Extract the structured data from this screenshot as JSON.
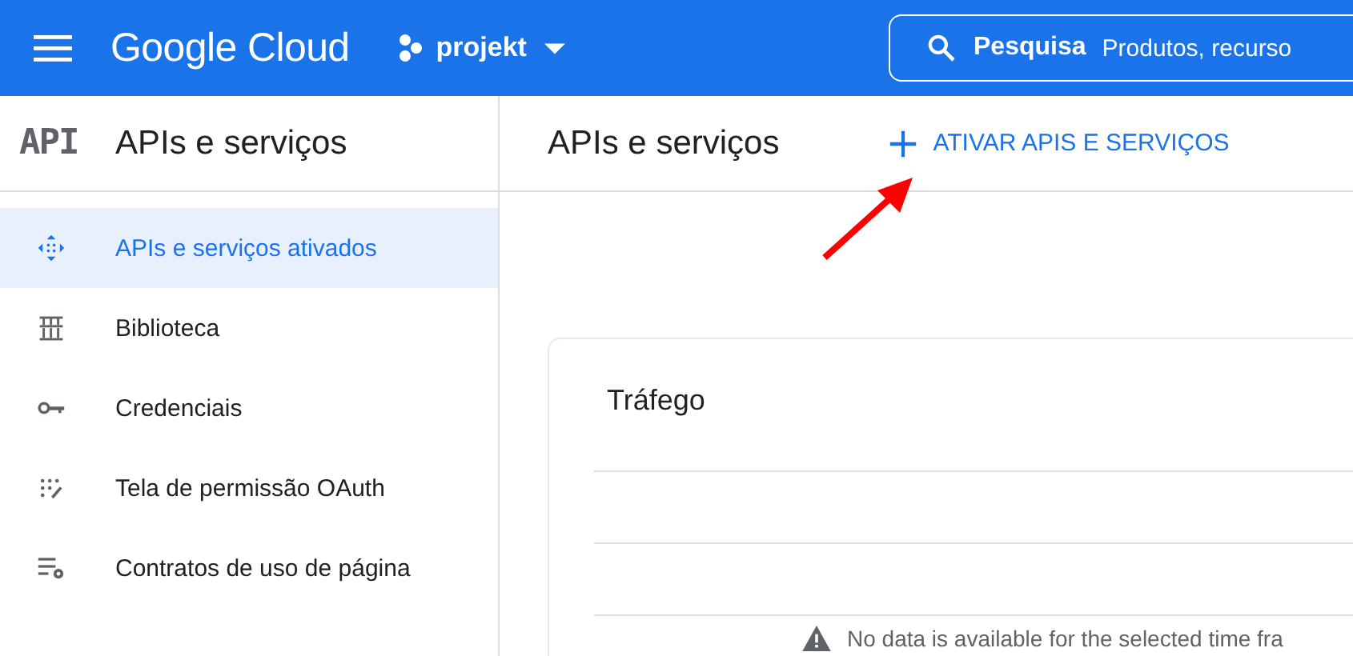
{
  "header": {
    "brand": "Google Cloud",
    "project": "projekt",
    "search": {
      "label": "Pesquisa",
      "placeholder": "Produtos, recurso"
    }
  },
  "sidebar": {
    "logo": "API",
    "title": "APIs e serviços",
    "items": [
      {
        "label": "APIs e serviços ativados",
        "selected": true
      },
      {
        "label": "Biblioteca",
        "selected": false
      },
      {
        "label": "Credenciais",
        "selected": false
      },
      {
        "label": "Tela de permissão OAuth",
        "selected": false
      },
      {
        "label": "Contratos de uso de página",
        "selected": false
      }
    ]
  },
  "main": {
    "title": "APIs e serviços",
    "action": "ATIVAR APIS E SERVIÇOS",
    "card": {
      "title": "Tráfego",
      "message": "No data is available for the selected time fra"
    }
  }
}
